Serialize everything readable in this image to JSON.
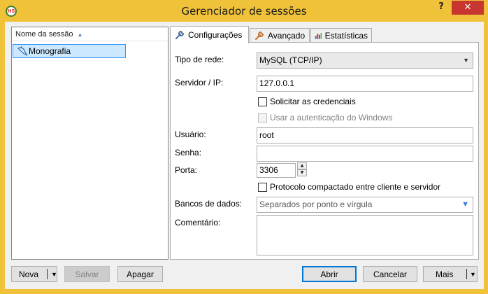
{
  "window": {
    "title": "Gerenciador de sessões",
    "help_label": "?",
    "close_label": "✕",
    "app_icon_text": "HS"
  },
  "tree": {
    "column_header": "Nome da sessão",
    "sort_indicator": "▲",
    "items": [
      {
        "label": "Monografia",
        "icon": "dolphin-icon",
        "selected": true
      }
    ]
  },
  "tabs": [
    {
      "label": "Configurações",
      "icon": "wrench-icon",
      "active": true
    },
    {
      "label": "Avançado",
      "icon": "wrench-orange-icon",
      "active": false
    },
    {
      "label": "Estatísticas",
      "icon": "bar-chart-icon",
      "active": false
    }
  ],
  "form": {
    "network_type_label": "Tipo de rede:",
    "network_type_value": "MySQL (TCP/IP)",
    "server_label": "Servidor / IP:",
    "server_value": "127.0.0.1",
    "prompt_credentials_label": "Solicitar as credenciais",
    "prompt_credentials_checked": false,
    "windows_auth_label": "Usar a autenticação do Windows",
    "windows_auth_checked": false,
    "user_label": "Usuário:",
    "user_value": "root",
    "password_label": "Senha:",
    "password_value": "",
    "port_label": "Porta:",
    "port_value": "3306",
    "compressed_label": "Protocolo compactado entre cliente e servidor",
    "compressed_checked": false,
    "databases_label": "Bancos de dados:",
    "databases_placeholder": "Separados por ponto e vírgula",
    "comment_label": "Comentário:",
    "comment_value": ""
  },
  "buttons": {
    "new": "Nova",
    "save": "Salvar",
    "delete": "Apagar",
    "open": "Abrir",
    "cancel": "Cancelar",
    "more": "Mais",
    "dropdown_arrow": "▼"
  },
  "colors": {
    "title_bar": "#f0c23a",
    "close_button": "#c7372f",
    "selection": "#cce8ff",
    "accent": "#0078d7"
  }
}
